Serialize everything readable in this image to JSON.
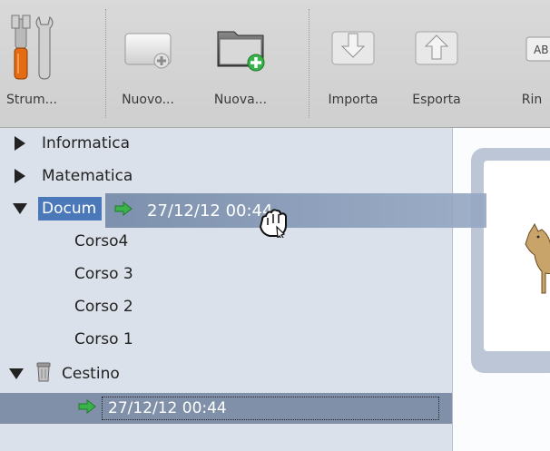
{
  "toolbar": {
    "items": [
      {
        "label": "Strum...",
        "icon": "tools-icon"
      },
      {
        "label": "Nuovo...",
        "icon": "new-document-icon"
      },
      {
        "label": "Nuova...",
        "icon": "new-folder-icon"
      },
      {
        "label": "Importa",
        "icon": "import-icon"
      },
      {
        "label": "Esporta",
        "icon": "export-icon"
      },
      {
        "label": "Rin",
        "icon": "rename-icon"
      }
    ],
    "rename_icon_text": "AB"
  },
  "tree": {
    "items": [
      {
        "label": "Informatica",
        "expanded": false
      },
      {
        "label": "Matematica",
        "expanded": false
      },
      {
        "label": "Docum",
        "expanded": true
      },
      {
        "label": "Corso4"
      },
      {
        "label": "Corso 3"
      },
      {
        "label": "Corso 2"
      },
      {
        "label": "Corso 1"
      },
      {
        "label": "Cestino",
        "expanded": true,
        "icon": "trash-icon"
      },
      {
        "label": "27/12/12 00:44",
        "icon": "arrow-right-icon",
        "selected": true
      }
    ]
  },
  "drag": {
    "label": "27/12/12 00:44",
    "icon": "arrow-right-icon"
  },
  "colors": {
    "selection": "#4a78b8",
    "drag_ghost": "#8c9fbb",
    "green_arrow": "#3bb24a"
  }
}
